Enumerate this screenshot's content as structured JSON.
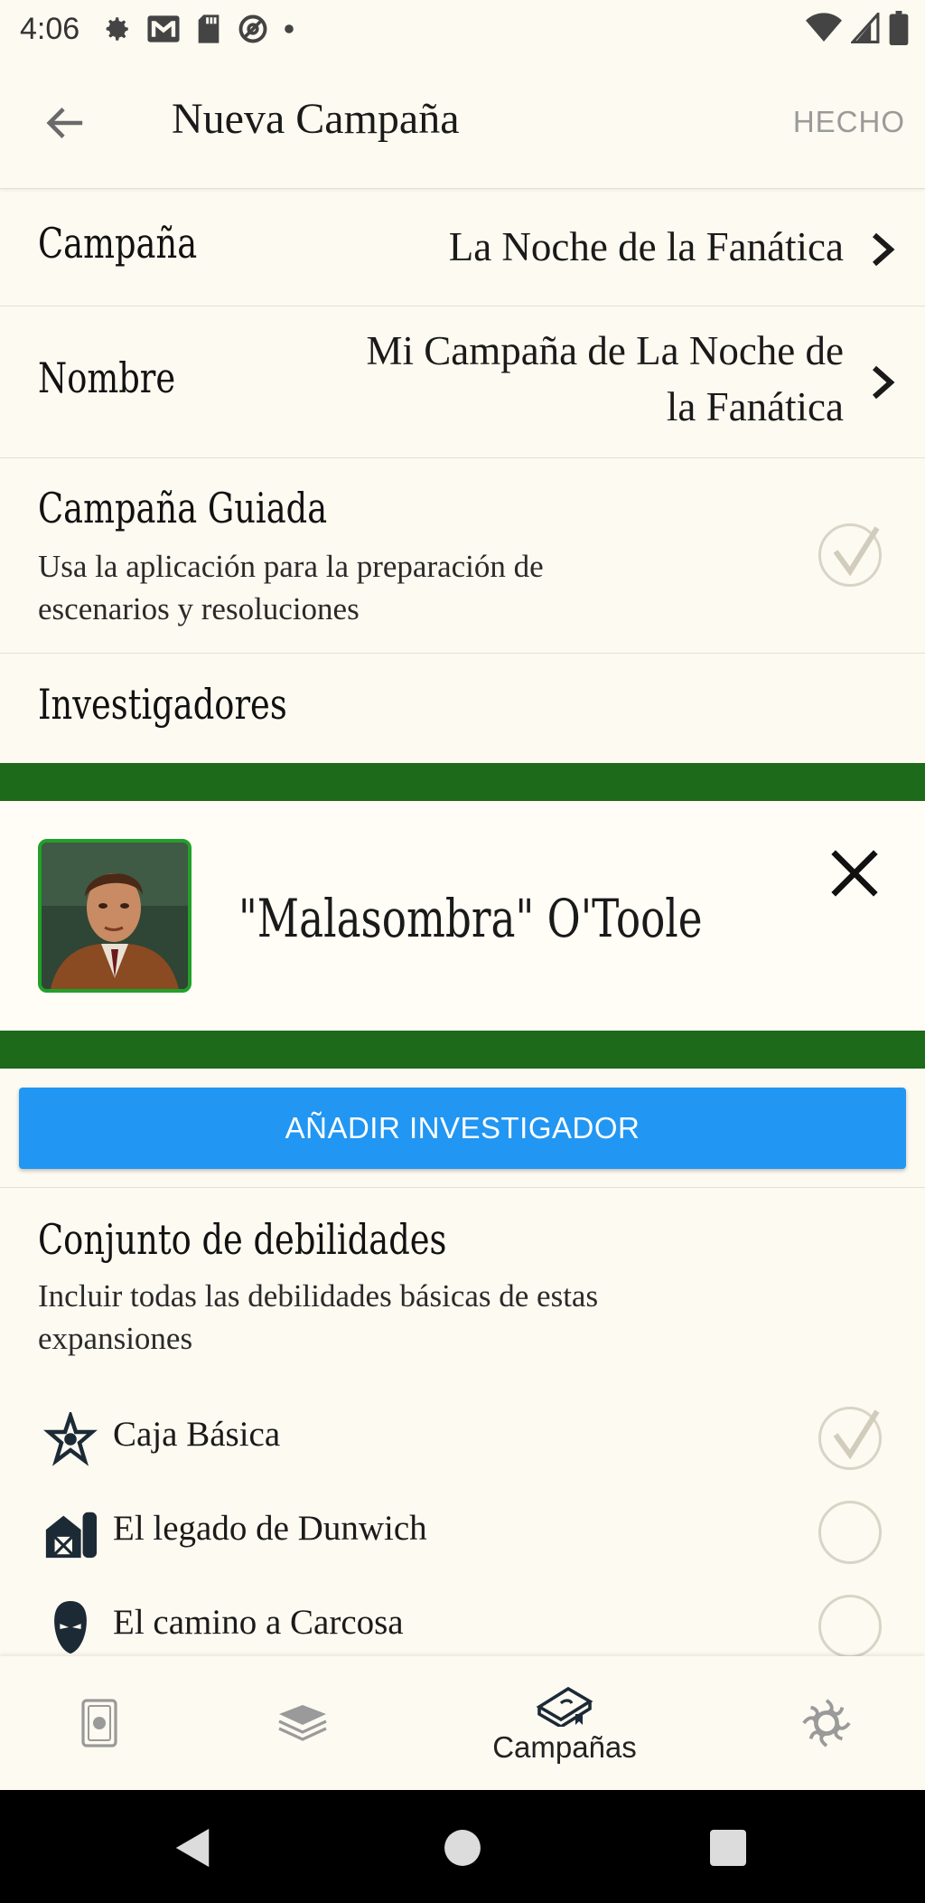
{
  "status_bar": {
    "time": "4:06"
  },
  "toolbar": {
    "title": "Nueva Campaña",
    "done_label": "HECHO"
  },
  "campaign_row": {
    "label": "Campaña",
    "value": "La Noche de la Fanática"
  },
  "name_row": {
    "label": "Nombre",
    "value_line1": "Mi Campaña de La Noche de",
    "value_line2": "la Fanática"
  },
  "guided_row": {
    "label": "Campaña Guiada",
    "description_line1": "Usa la aplicación para la preparación de",
    "description_line2": "escenarios y resoluciones",
    "checked": true
  },
  "investigators": {
    "heading": "Investigadores",
    "items": [
      {
        "name": "\"Malasombra\" O'Toole"
      }
    ],
    "add_label": "AÑADIR INVESTIGADOR"
  },
  "weakness_set": {
    "heading": "Conjunto de debilidades",
    "description_line1": "Incluir todas las debilidades básicas de estas",
    "description_line2": "expansiones",
    "expansions": [
      {
        "label": "Caja Básica",
        "icon": "core-set-icon",
        "checked": true
      },
      {
        "label": "El legado de Dunwich",
        "icon": "dunwich-icon",
        "checked": false
      },
      {
        "label": "El camino a Carcosa",
        "icon": "carcosa-icon",
        "checked": false
      }
    ]
  },
  "bottom_nav": {
    "items": [
      {
        "icon": "cards-icon",
        "label": ""
      },
      {
        "icon": "decks-icon",
        "label": ""
      },
      {
        "icon": "campaigns-icon",
        "label": "Campañas",
        "active": true
      },
      {
        "icon": "settings-icon",
        "label": ""
      }
    ]
  },
  "colors": {
    "accent_green": "#1d6a1a",
    "button_blue": "#2196f3",
    "background": "#fdfaf1"
  }
}
